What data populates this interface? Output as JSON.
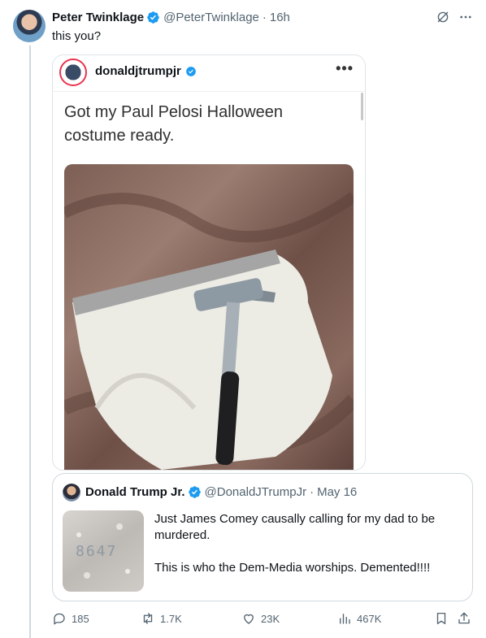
{
  "post": {
    "display_name": "Peter Twinklage",
    "handle": "@PeterTwinklage",
    "separator": "·",
    "time": "16h",
    "text": "this you?"
  },
  "embed": {
    "username": "donaldjtrumpjr",
    "caption": "Got my Paul Pelosi Halloween costume ready."
  },
  "quote": {
    "display_name": "Donald Trump Jr.",
    "handle": "@DonaldJTrumpJr",
    "separator": "·",
    "date": "May 16",
    "paragraph1": "Just James Comey causally calling for my dad to be murdered.",
    "paragraph2": "This is who the Dem-Media worships. Demented!!!!",
    "thumb_text": "8647"
  },
  "actions": {
    "replies": "185",
    "reposts": "1.7K",
    "likes": "23K",
    "views": "467K"
  },
  "colors": {
    "verified": "#1d9bf0",
    "muted": "#536471",
    "border": "#cfd9de"
  }
}
